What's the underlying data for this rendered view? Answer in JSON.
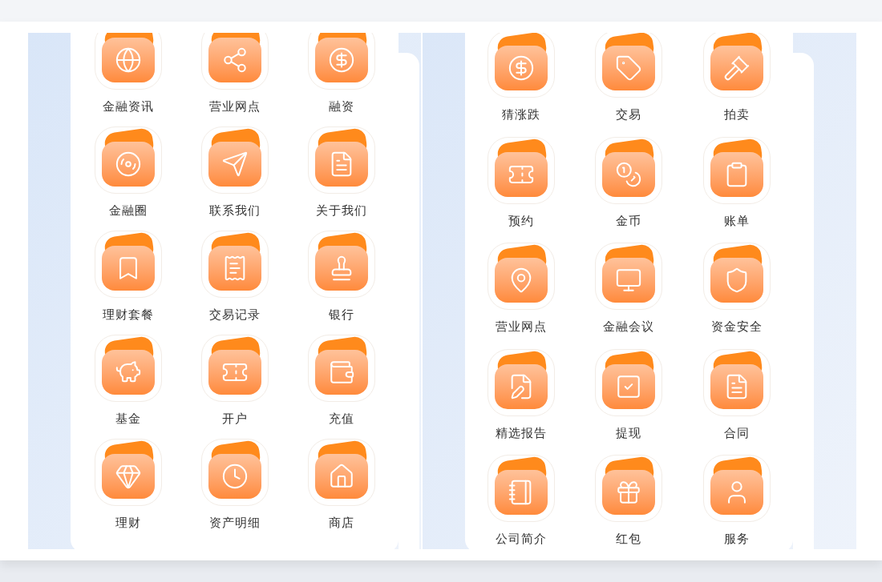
{
  "left_card": {
    "items": [
      {
        "label": "金融资讯"
      },
      {
        "label": "营业网点"
      },
      {
        "label": "融资"
      },
      {
        "label": "金融圈"
      },
      {
        "label": "联系我们"
      },
      {
        "label": "关于我们"
      },
      {
        "label": "理财套餐"
      },
      {
        "label": "交易记录"
      },
      {
        "label": "银行"
      },
      {
        "label": "基金"
      },
      {
        "label": "开户"
      },
      {
        "label": "充值"
      },
      {
        "label": "理财"
      },
      {
        "label": "资产明细"
      },
      {
        "label": "商店"
      }
    ]
  },
  "right_card": {
    "items": [
      {
        "label": "猜涨跌"
      },
      {
        "label": "交易"
      },
      {
        "label": "拍卖"
      },
      {
        "label": "预约"
      },
      {
        "label": "金币"
      },
      {
        "label": "账单"
      },
      {
        "label": "营业网点"
      },
      {
        "label": "金融会议"
      },
      {
        "label": "资金安全"
      },
      {
        "label": "精选报告"
      },
      {
        "label": "提现"
      },
      {
        "label": "合同"
      },
      {
        "label": "公司简介"
      },
      {
        "label": "红包"
      },
      {
        "label": "服务"
      }
    ]
  }
}
